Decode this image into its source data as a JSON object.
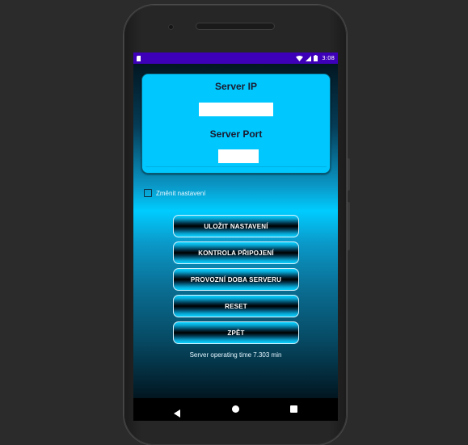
{
  "status_bar": {
    "time": "3:08",
    "background": "#3d00b8"
  },
  "settings_card": {
    "server_ip_label": "Server IP",
    "server_ip_value": "",
    "server_port_label": "Server Port",
    "server_port_value": "",
    "background": "#00c8ff"
  },
  "change_settings": {
    "label": "Změnit nastavení",
    "checked": false
  },
  "buttons": {
    "save": "ULOŽIT NASTAVENÍ",
    "check_connection": "KONTROLA PŘIPOJENÍ",
    "server_uptime": "PROVOZNÍ DOBA SERVERU",
    "reset": "RESET",
    "back": "ZPĚT"
  },
  "operating_time_text": "Server operating time 7.303 min",
  "navigation": {
    "back_icon": "triangle-back-icon",
    "home_icon": "circle-home-icon",
    "recents_icon": "square-recents-icon"
  }
}
